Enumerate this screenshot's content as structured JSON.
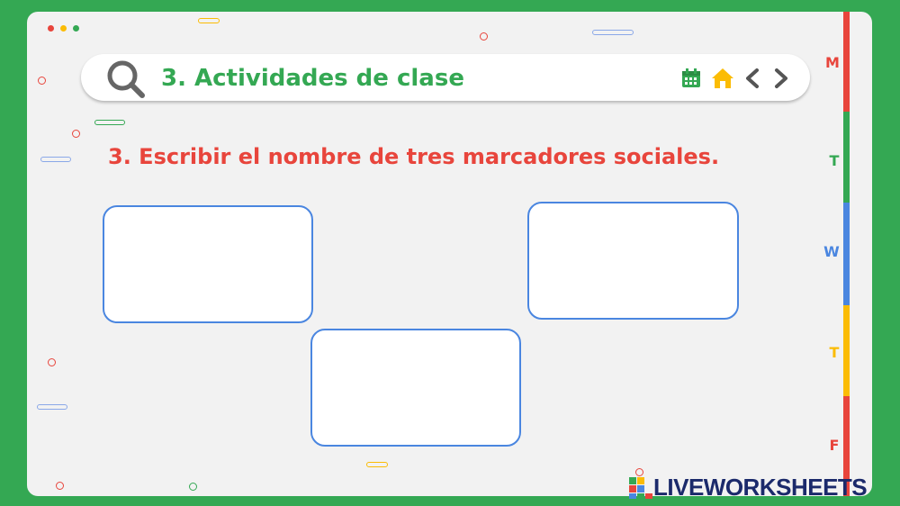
{
  "header": {
    "title": "3. Actividades de clase",
    "icons": [
      "search-icon",
      "calendar-icon",
      "home-icon",
      "chevron-left-icon",
      "chevron-right-icon"
    ]
  },
  "question": "3. Escribir el nombre de tres marcadores sociales.",
  "answers": [
    {
      "label": "answer-1",
      "value": ""
    },
    {
      "label": "answer-2",
      "value": ""
    },
    {
      "label": "answer-3",
      "value": ""
    }
  ],
  "side_tabs": [
    {
      "letter": "M",
      "color": "#e8453c"
    },
    {
      "letter": "T",
      "color": "#34a853"
    },
    {
      "letter": "W",
      "color": "#4a86e0"
    },
    {
      "letter": "T",
      "color": "#fbbc05"
    },
    {
      "letter": "F",
      "color": "#e8453c"
    }
  ],
  "window_dots": [
    "#e8453c",
    "#fbbc05",
    "#34a853"
  ],
  "footer": {
    "brand": "LIVEWORKSHEETS"
  }
}
